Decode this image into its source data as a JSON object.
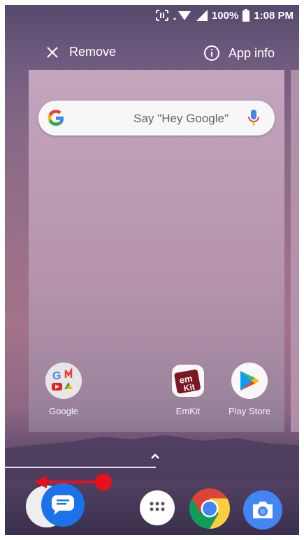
{
  "status_bar": {
    "battery": "100%",
    "time": "1:08 PM"
  },
  "recents_header": {
    "remove_label": "Remove",
    "app_info_label": "App info"
  },
  "search": {
    "placeholder": "Say \"Hey Google\""
  },
  "apps": [
    {
      "label": "Google",
      "icon": "google-folder-icon"
    },
    {
      "label": "EmKit",
      "icon": "emkit-icon"
    },
    {
      "label": "Play Store",
      "icon": "play-store-icon"
    }
  ],
  "dock": [
    "messages-icon",
    "app-drawer-icon",
    "chrome-icon",
    "camera-icon"
  ],
  "colors": {
    "accent_blue": "#1a73e8",
    "gesture_red": "#e8101a"
  }
}
